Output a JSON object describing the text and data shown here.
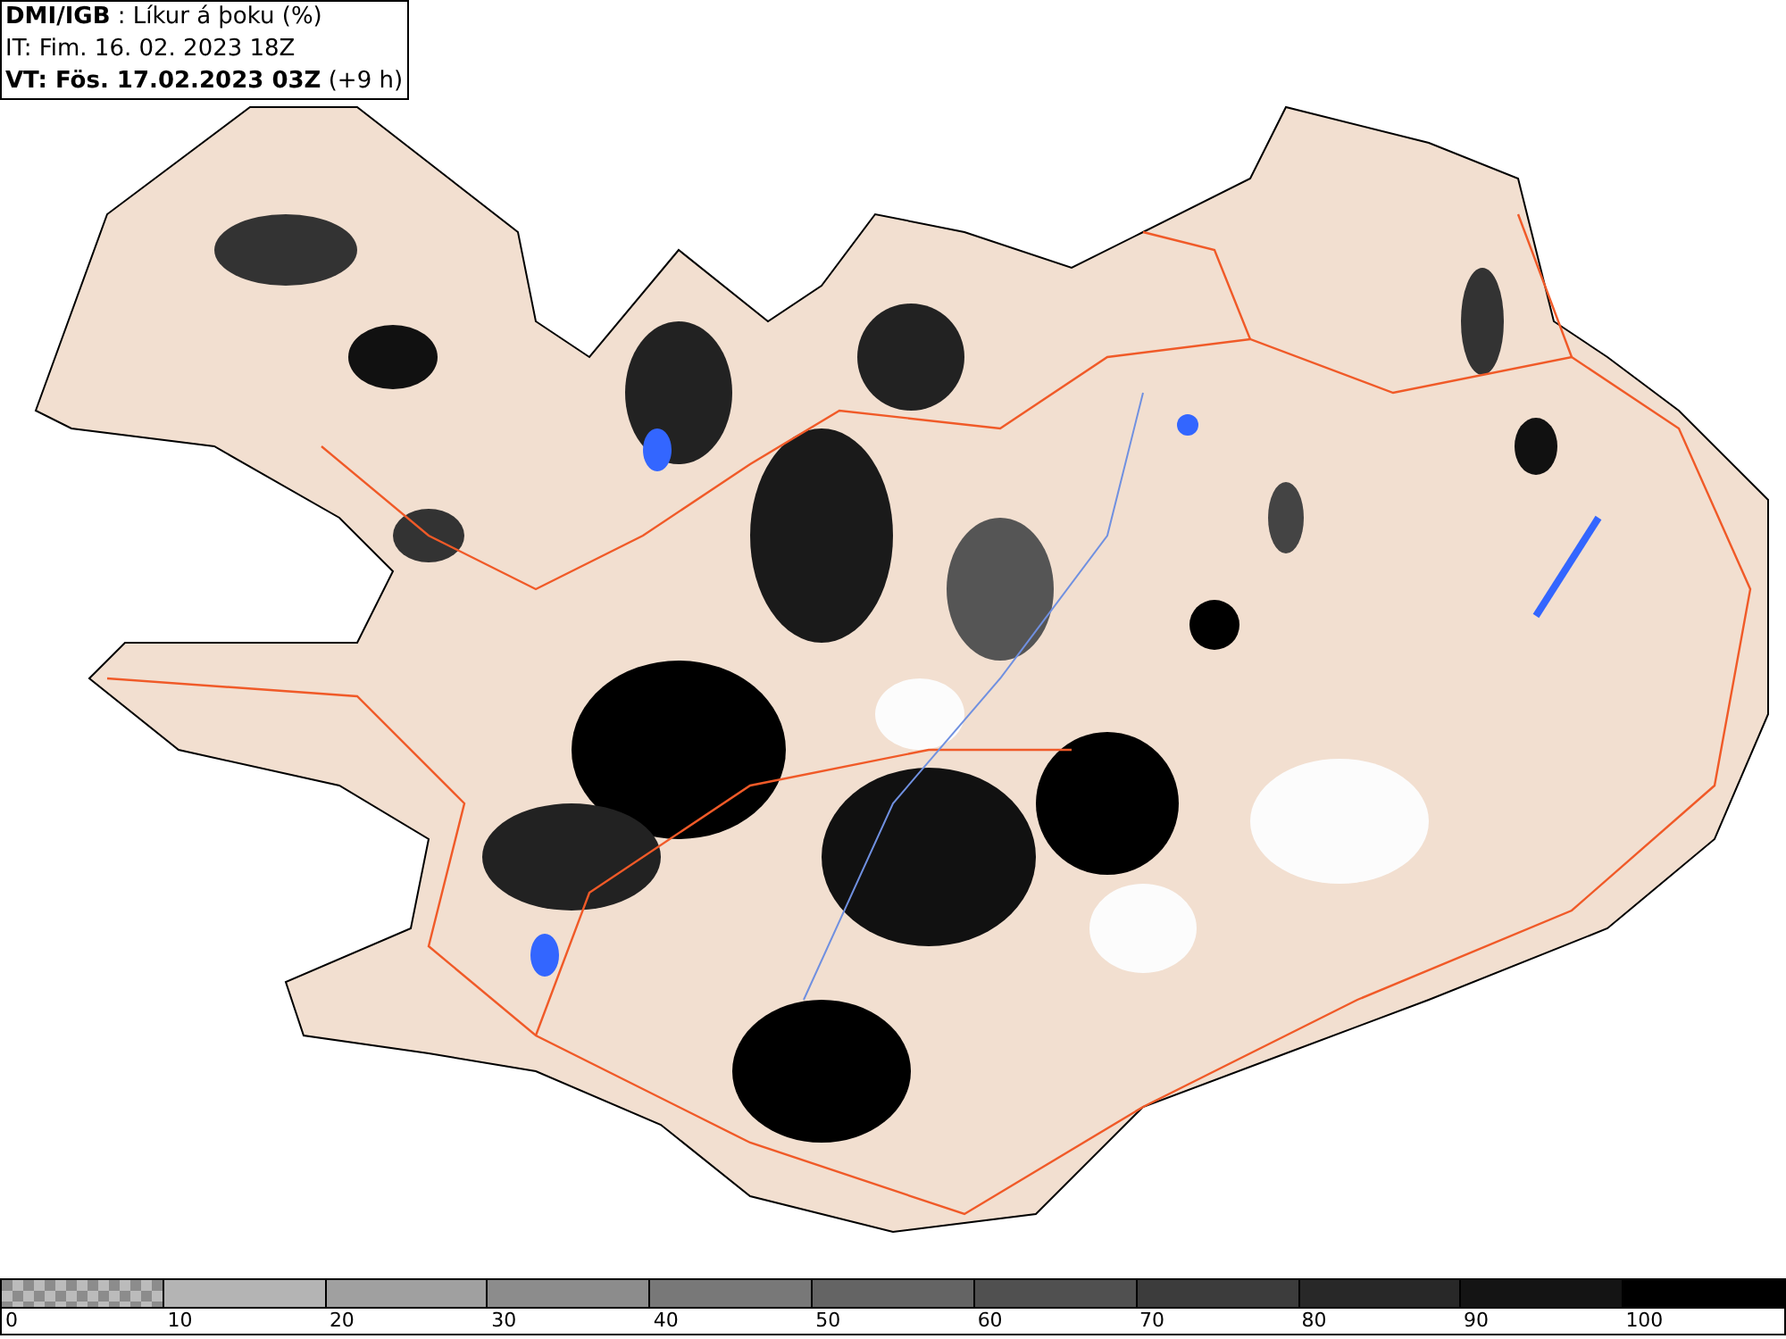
{
  "header": {
    "title": "**DMI/IGB** : Líkur á þoku (%)",
    "init_time": "IT: Fim. 16. 02. 2023 18Z",
    "valid_time": "**VT: Fös. 17.02.2023 03Z** (+9 h)"
  },
  "colorbar": {
    "segments": [
      {
        "kind": "checker",
        "color": "#8c8c8c"
      },
      {
        "kind": "solid",
        "color": "#b4b4b4"
      },
      {
        "kind": "solid",
        "color": "#a0a0a0"
      },
      {
        "kind": "solid",
        "color": "#8c8c8c"
      },
      {
        "kind": "solid",
        "color": "#787878"
      },
      {
        "kind": "solid",
        "color": "#646464"
      },
      {
        "kind": "solid",
        "color": "#505050"
      },
      {
        "kind": "solid",
        "color": "#3c3c3c"
      },
      {
        "kind": "solid",
        "color": "#282828"
      },
      {
        "kind": "solid",
        "color": "#141414"
      },
      {
        "kind": "solid",
        "color": "#000000"
      }
    ],
    "ticks": [
      "0",
      "10",
      "20",
      "30",
      "40",
      "50",
      "60",
      "70",
      "80",
      "90",
      "100"
    ]
  }
}
